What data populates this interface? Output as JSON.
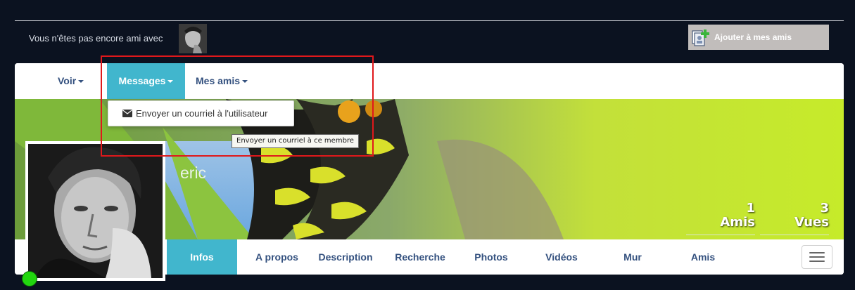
{
  "notice": {
    "text": "Vous n'êtes pas encore ami avec"
  },
  "add_friend": {
    "label": "Ajouter à mes amis",
    "icon": "add-friend-icon"
  },
  "menu": {
    "items": [
      {
        "label": "Voir"
      },
      {
        "label": "Messages"
      },
      {
        "label": "Mes amis"
      }
    ],
    "active": "Messages"
  },
  "dropdown": {
    "items": [
      {
        "label": "Envoyer un courriel à l'utilisateur",
        "icon": "envelope-icon"
      }
    ]
  },
  "tooltip": {
    "text": "Envoyer un courriel à ce membre"
  },
  "profile": {
    "name": "eric",
    "online": true
  },
  "stats": [
    {
      "value": "1",
      "label": "Amis"
    },
    {
      "value": "3",
      "label": "Vues"
    }
  ],
  "tabs": {
    "items": [
      {
        "label": "Infos"
      },
      {
        "label": "A propos"
      },
      {
        "label": "Description"
      },
      {
        "label": "Recherche"
      },
      {
        "label": "Photos"
      },
      {
        "label": "Vidéos"
      },
      {
        "label": "Mur"
      },
      {
        "label": "Amis"
      }
    ],
    "active": "Infos"
  },
  "colors": {
    "background": "#0b1220",
    "accent": "#41b6cd",
    "link": "#34517f",
    "highlight": "#e0181b",
    "online": "#22d60f"
  }
}
